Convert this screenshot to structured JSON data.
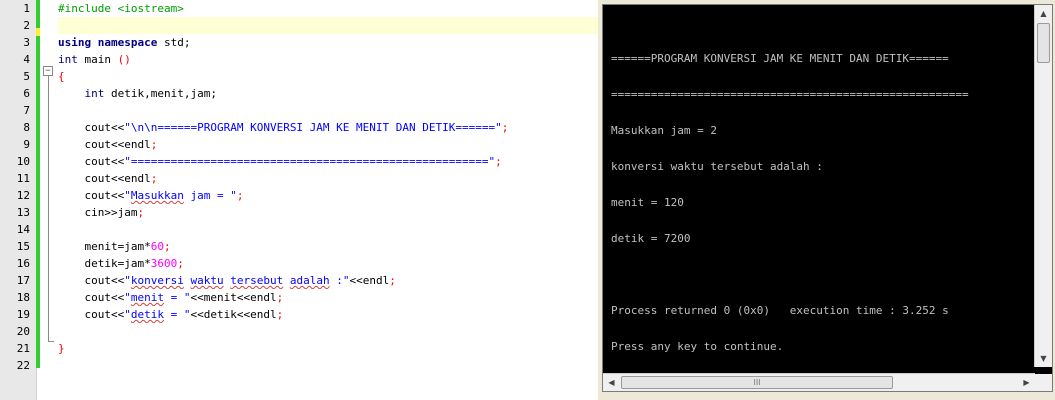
{
  "editor": {
    "line_numbers": [
      "1",
      "2",
      "3",
      "4",
      "5",
      "6",
      "7",
      "8",
      "9",
      "10",
      "11",
      "12",
      "13",
      "14",
      "15",
      "16",
      "17",
      "18",
      "19",
      "20",
      "21",
      "22"
    ],
    "fold_marker": "−",
    "lines": {
      "l1": {
        "directive": "#include <iostream>"
      },
      "l3": {
        "kw1": "using",
        "kw2": "namespace",
        "rest": " std;"
      },
      "l4": {
        "type": "int",
        "name": " main ",
        "paren": "()"
      },
      "l5": {
        "brace": "{"
      },
      "l6": {
        "type": "int",
        "rest": " detik,menit,jam;"
      },
      "l8": {
        "a": "cout<<",
        "s": "\"\\n\\n======PROGRAM KONVERSI JAM KE MENIT DAN DETIK======\"",
        "e": ";"
      },
      "l9": {
        "a": "cout<<",
        "b": "endl",
        "e": ";"
      },
      "l10": {
        "a": "cout<<",
        "s": "\"======================================================\"",
        "e": ";"
      },
      "l11": {
        "a": "cout<<",
        "b": "endl",
        "e": ";"
      },
      "l12": {
        "a": "cout<<",
        "q": "\"",
        "w": "Masukkan",
        "s": " jam = \"",
        "e": ";"
      },
      "l13": {
        "a": "cin>>",
        "b": "jam",
        "e": ";"
      },
      "l15": {
        "a": "menit=jam*",
        "n": "60",
        "e": ";"
      },
      "l16": {
        "a": "detik=jam*",
        "n": "3600",
        "e": ";"
      },
      "l17": {
        "a": "cout<<",
        "q": "\"",
        "w1": "konversi",
        "sp1": " ",
        "w2": "waktu",
        "sp2": " ",
        "w3": "tersebut",
        "sp3": " ",
        "w4": "adalah",
        "s": " :\"",
        "b": "<<endl",
        "e": ";"
      },
      "l18": {
        "a": "cout<<",
        "q": "\"",
        "w": "menit",
        "s": " = \"",
        "b": "<<menit<<endl",
        "e": ";"
      },
      "l19": {
        "a": "cout<<",
        "q": "\"",
        "w": "detik",
        "s": " = \"",
        "b": "<<detik<<endl",
        "e": ";"
      },
      "l21": {
        "brace": "}"
      }
    }
  },
  "console": {
    "output": [
      "======PROGRAM KONVERSI JAM KE MENIT DAN DETIK======",
      "======================================================",
      "Masukkan jam = 2",
      "konversi waktu tersebut adalah :",
      "menit = 120",
      "detik = 7200",
      "",
      "Process returned 0 (0x0)   execution time : 3.252 s",
      "Press any key to continue."
    ],
    "scroll_up": "▲",
    "scroll_down": "▼",
    "scroll_left": "◀",
    "scroll_right": "▶",
    "hthumb_grip": "III"
  },
  "colors": {
    "keyword": "#00007f",
    "string": "#0000ff",
    "number": "#ff00ff",
    "preprocessor": "#00a000",
    "change_bar": "#33cc33",
    "console_bg": "#000000",
    "console_fg": "#c0c0c0"
  }
}
